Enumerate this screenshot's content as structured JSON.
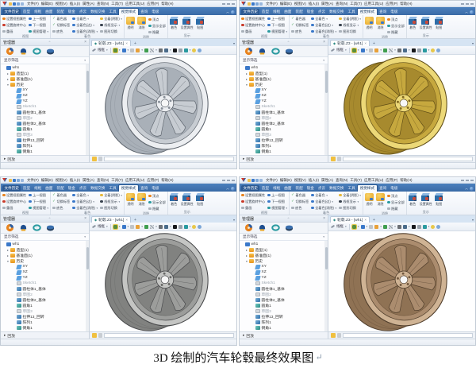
{
  "caption": {
    "text": "3D 绘制的汽车轮毂最终效果图",
    "mark": "↵"
  },
  "glyphs": {
    "caret_down": "▾",
    "caret_right": "▸",
    "close": "×",
    "add": "+",
    "diamond": "◆",
    "check": "✓",
    "collapse": "︿",
    "pane": "▫"
  },
  "app": {
    "menus": [
      "文件(F)",
      "编辑(E)",
      "视图(V)",
      "插入(I)",
      "属性(A)",
      "查询(N)",
      "工具(T)",
      "应用工具(U)",
      "应用(P)",
      "帮助(H)"
    ],
    "ribbon_tabs": [
      "文件历史",
      "造型",
      "线框",
      "曲面",
      "装配",
      "钣金",
      "点云",
      "数据交换",
      "工具",
      "视觉样式",
      "查询",
      "电极"
    ],
    "active_tab": "视觉样式",
    "ribbon": {
      "g1": {
        "label": "视图",
        "col1": [
          "设置视图属性",
          "设置旋转中心",
          "重画"
        ],
        "col2": [
          "上一视图",
          "下一视图",
          "视图管理"
        ]
      },
      "g2": {
        "label": "着色",
        "col1": [
          "着色器",
          "切换标签",
          "底色"
        ],
        "col2": [
          "全着色",
          "全着色(边)",
          "全着色(消隐)"
        ],
        "col3": [
          "全着(阴影)",
          "线框显示",
          "图形切换"
        ]
      },
      "g3": {
        "label": "消隐",
        "big": [
          "透明",
          "消隐"
        ],
        "col": [
          "顶点",
          "显示全部",
          "隐藏"
        ]
      },
      "g4": {
        "label": "显示",
        "big": [
          "着色",
          "设置属性",
          "贴图"
        ]
      }
    },
    "doc_tab": {
      "label": "轮毂.Z3 - [wh1]"
    },
    "viewport_toolbar": {
      "label": "线框"
    },
    "manager": {
      "title": "管理器",
      "filter": "显示筛选",
      "replay": "回放",
      "rows": [
        {
          "label": "wh1"
        },
        {
          "label": "造型(1)"
        },
        {
          "label": "基准面(1)"
        },
        {
          "label": "历史"
        },
        {
          "label": "XY"
        },
        {
          "label": "XZ"
        },
        {
          "label": "YZ"
        },
        {
          "label": "Sketch1"
        },
        {
          "label": "圆柱体1_基体"
        },
        {
          "label": "草图2"
        },
        {
          "label": "圆柱体2_基体"
        },
        {
          "label": "圆角1"
        },
        {
          "label": "草图3"
        },
        {
          "label": "拉伸13_回转"
        },
        {
          "label": "阵列1"
        },
        {
          "label": "倒角1"
        }
      ]
    }
  },
  "panels": [
    {
      "name": "silver-wheel",
      "colors": {
        "light": "#eceef1",
        "base": "#c7ccd2",
        "mid": "#a9b0b8",
        "dark": "#878e97",
        "line": "#5c636c"
      }
    },
    {
      "name": "gold-wheel",
      "colors": {
        "light": "#ecd877",
        "base": "#c6a83e",
        "mid": "#a78a2e",
        "dark": "#80671f",
        "line": "#5e4c15"
      }
    },
    {
      "name": "gunmetal-wheel",
      "colors": {
        "light": "#c4c5c3",
        "base": "#9c9d9b",
        "mid": "#818280",
        "dark": "#666765",
        "line": "#47484a"
      }
    },
    {
      "name": "bronze-wheel",
      "colors": {
        "light": "#cfb394",
        "base": "#ab8c6e",
        "mid": "#8f7254",
        "dark": "#70573e",
        "line": "#4f3d2b"
      }
    }
  ]
}
